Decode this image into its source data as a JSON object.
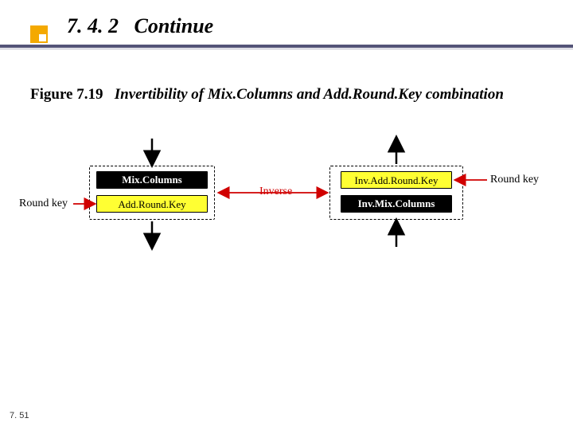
{
  "header": {
    "section_number": "7. 4. 2",
    "section_word": "Continue"
  },
  "figure": {
    "label": "Figure 7.19",
    "title": "Invertibility of Mix.Columns and Add.Round.Key combination"
  },
  "diagram": {
    "left_box": {
      "top_step": "Mix.Columns",
      "bottom_step": "Add.Round.Key"
    },
    "right_box": {
      "top_step": "Inv.Add.Round.Key",
      "bottom_step": "Inv.Mix.Columns"
    },
    "labels": {
      "round_key_left": "Round key",
      "inverse": "Inverse",
      "round_key_right": "Round key"
    }
  },
  "page_number": "7. 51"
}
